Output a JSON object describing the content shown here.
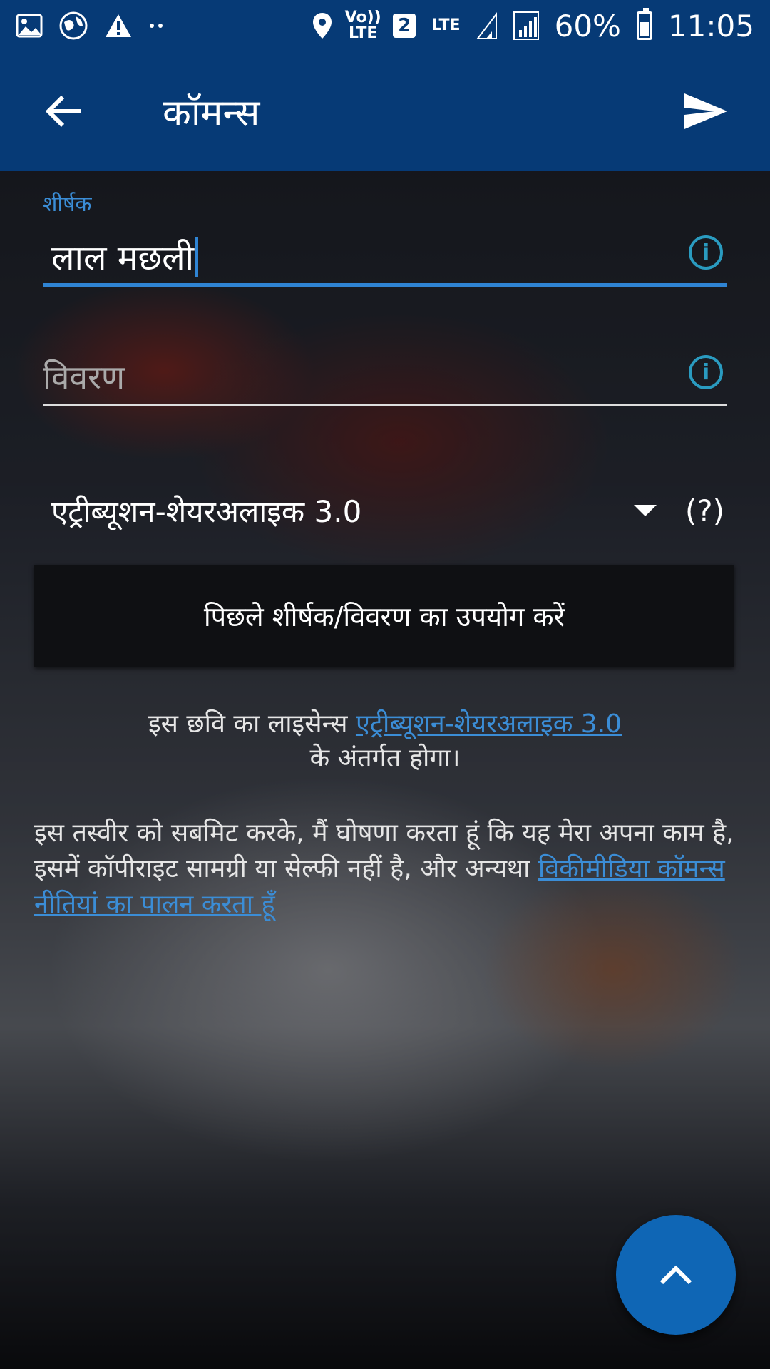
{
  "status_bar": {
    "volte": "Vo)) LTE",
    "sim_slot": "2",
    "lte": "LTE",
    "battery": "60%",
    "time": "11:05"
  },
  "app_bar": {
    "title": "कॉमन्स"
  },
  "form": {
    "title_label": "शीर्षक",
    "title_value": "लाल मछली",
    "description_placeholder": "विवरण",
    "license_selected": "एट्रीब्यूशन-शेयरअलाइक 3.0",
    "license_help": "(?)",
    "use_previous_button": "पिछले शीर्षक/विवरण का उपयोग करें"
  },
  "license_note": {
    "prefix": "इस छवि का लाइसेन्स ",
    "license_link": "एट्रीब्यूशन-शेयरअलाइक 3.0",
    "suffix": "के अंतर्गत होगा।"
  },
  "declaration": {
    "text": "इस तस्वीर को सबमिट करके, मैं घोषणा करता हूं कि यह मेरा अपना काम है, इसमें कॉपीराइट सामग्री या सेल्फी नहीं है, और अन्यथा ",
    "policy_link": "विकीमीडिया कॉमन्स नीतियां का पालन करता हूँ"
  },
  "colors": {
    "app_bar": "#063a76",
    "accent": "#2f84d3",
    "info_icon": "#2a9bc0",
    "fab": "#0f66b5"
  }
}
